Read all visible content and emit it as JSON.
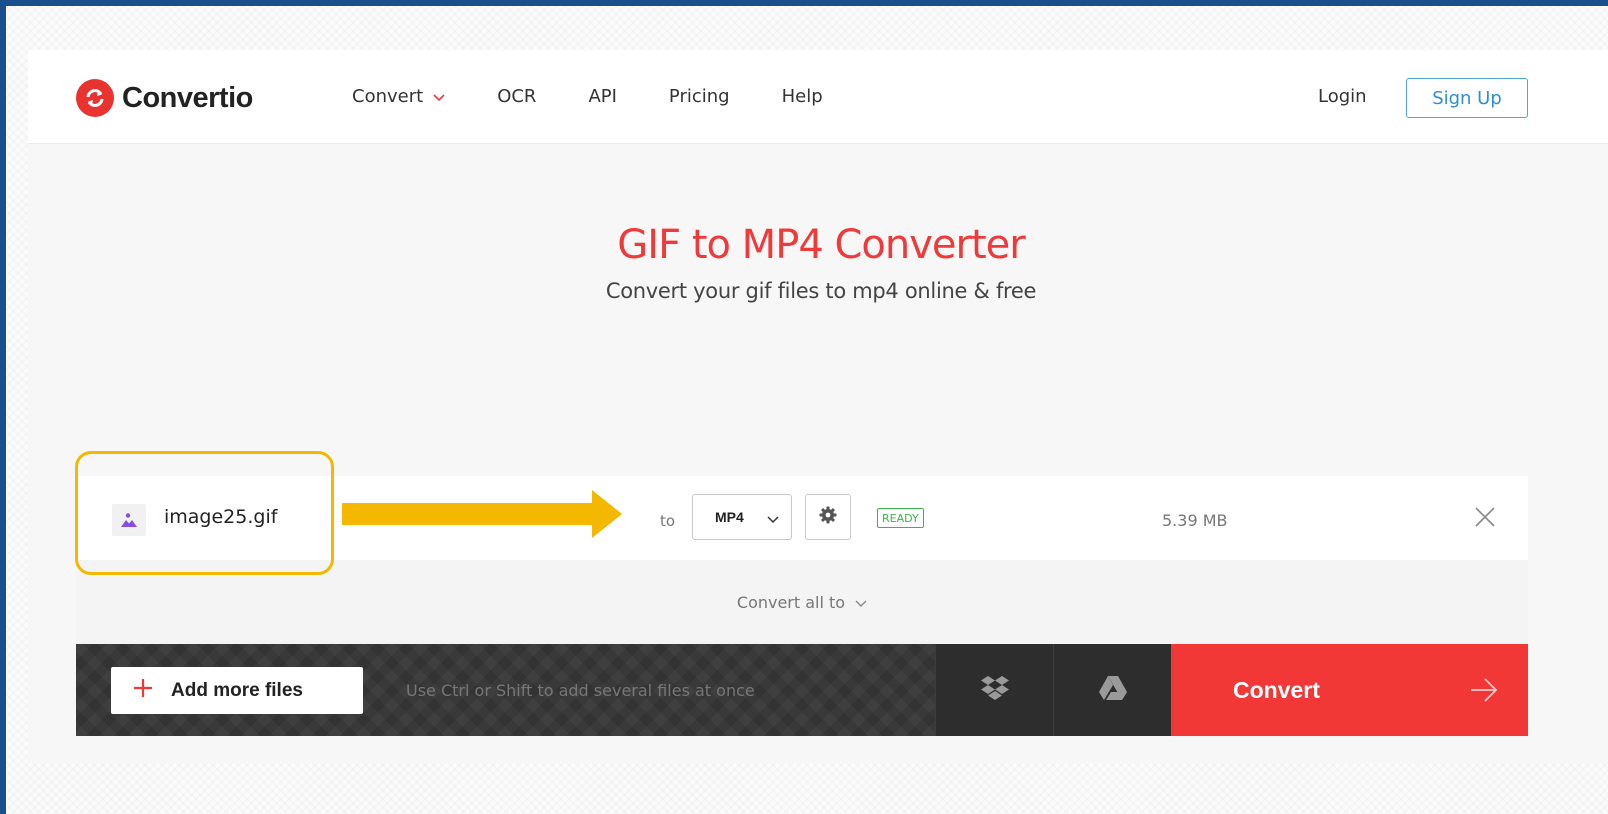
{
  "brand": {
    "name": "Convertio",
    "logo_color": "#e8332f"
  },
  "nav": {
    "items": [
      {
        "label": "Convert",
        "has_dropdown": true
      },
      {
        "label": "OCR"
      },
      {
        "label": "API"
      },
      {
        "label": "Pricing"
      },
      {
        "label": "Help"
      }
    ],
    "login_label": "Login",
    "signup_label": "Sign Up"
  },
  "hero": {
    "title": "GIF to MP4 Converter",
    "subtitle": "Convert your gif files to mp4 online & free"
  },
  "file": {
    "name": "image25.gif",
    "icon": "image-icon",
    "to_label": "to",
    "target_format": "MP4",
    "status": "READY",
    "size": "5.39 MB"
  },
  "convert_all": {
    "label": "Convert all to"
  },
  "toolbar": {
    "add_files_label": "Add more files",
    "hint": "Use Ctrl or Shift to add several files at once",
    "dropbox_icon": "dropbox-icon",
    "gdrive_icon": "google-drive-icon",
    "convert_label": "Convert"
  },
  "colors": {
    "accent_red": "#f23737",
    "title_red": "#f03a3a",
    "signup_blue": "#2f8fcc",
    "ready_green": "#3bb54a",
    "annotation_yellow": "#f5b800",
    "frame_blue": "#1a4f8b"
  }
}
